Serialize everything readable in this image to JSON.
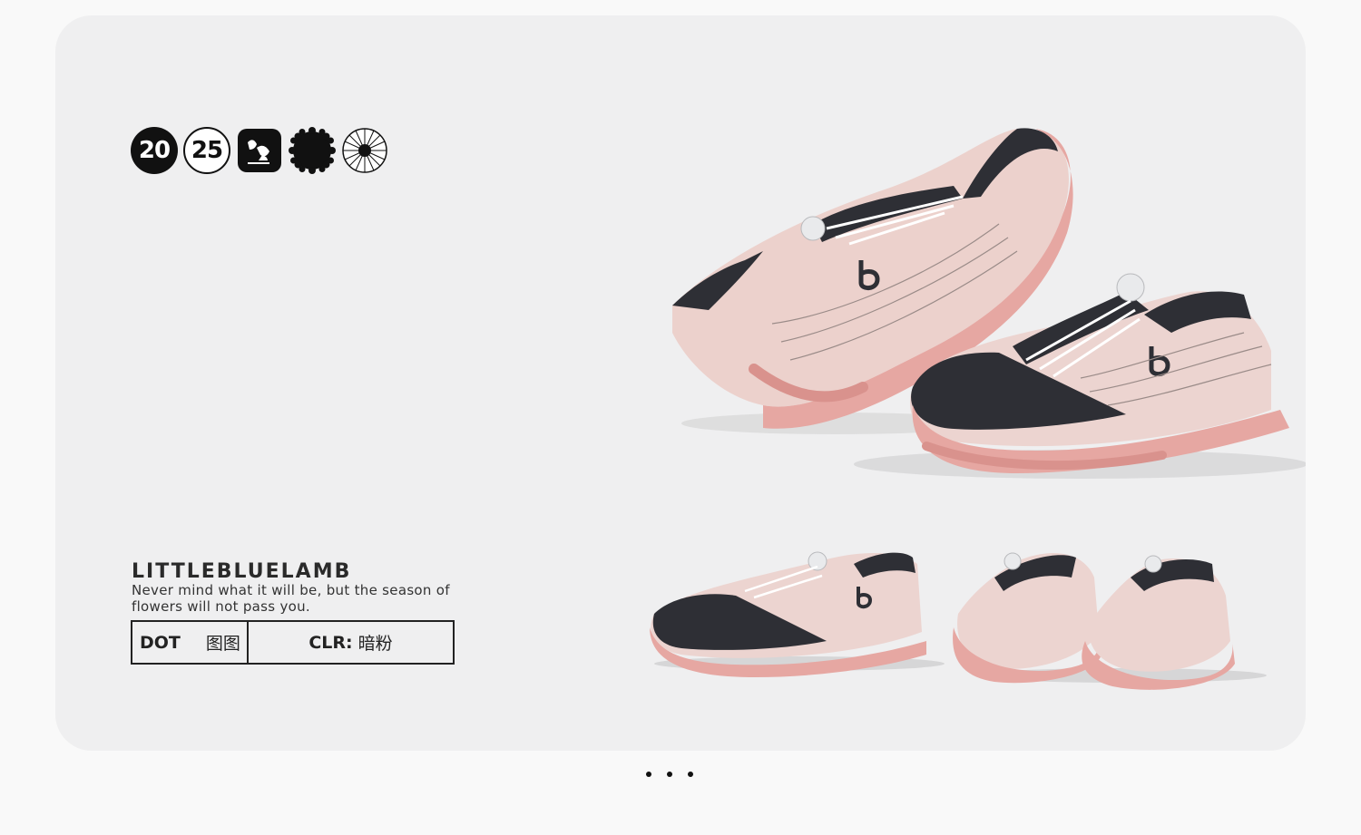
{
  "badges": {
    "year_part1": "20",
    "year_part2": "25",
    "icon_feet": "feet-icon",
    "icon_seal": "scalloped-seal-icon",
    "icon_sun": "sunburst-icon"
  },
  "brand": {
    "name": "LITTLEBLUELAMB",
    "tagline": "Never mind what it will be, but the season of flowers will not pass you."
  },
  "spec": {
    "dot_label": "DOT",
    "dot_value": "图图",
    "clr_label": "CLR:",
    "clr_value": "暗粉"
  },
  "product_images": {
    "hero": "pink-sneaker-pair-floating",
    "side": "pink-sneaker-side-view",
    "back": "pink-sneaker-pair-rear-view"
  },
  "pagination": {
    "dots": 3
  },
  "colors": {
    "card_bg": "#efeff0",
    "page_bg": "#f9f9f9",
    "shoe_pink": "#e8a7a3",
    "shoe_upper": "#ecd4d0",
    "shoe_dark": "#2e2f35"
  }
}
